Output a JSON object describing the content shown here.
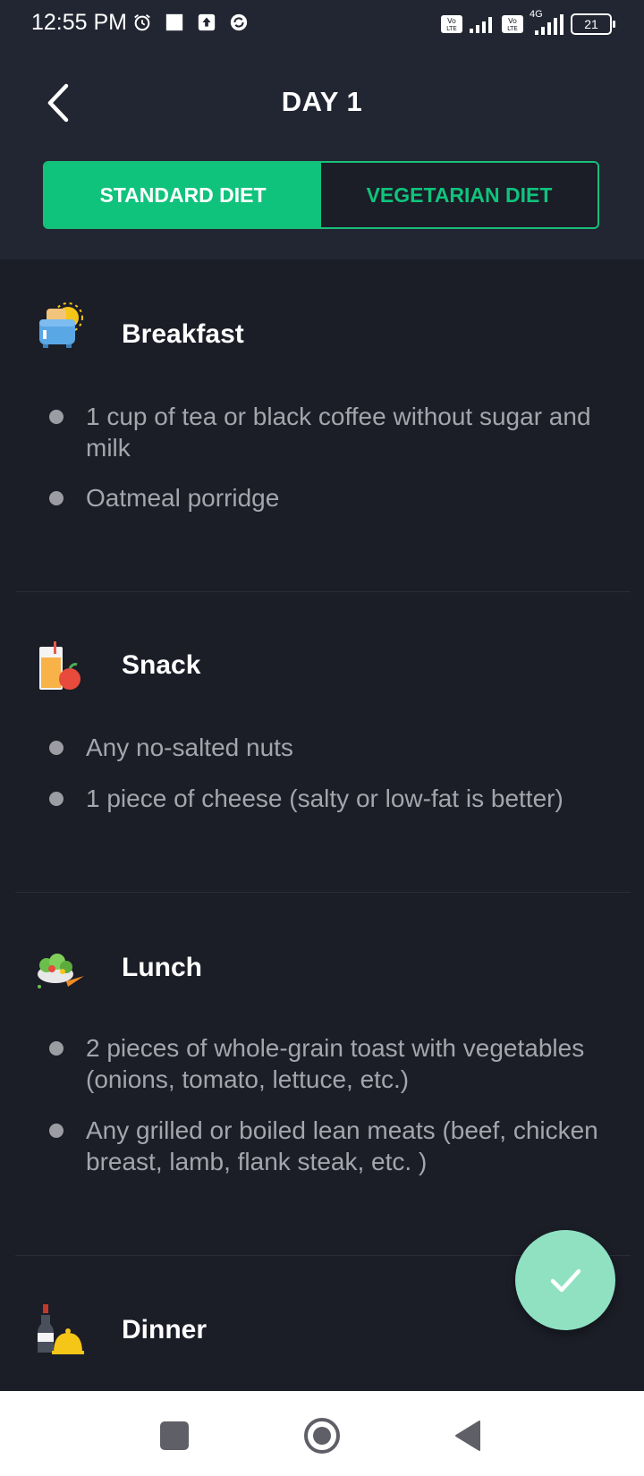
{
  "status_bar": {
    "time": "12:55 PM",
    "network": "4G",
    "battery": "21",
    "icons": [
      "alarm-icon",
      "square-notification-icon",
      "upload-icon",
      "sync-icon",
      "volte-icon",
      "signal-icon",
      "volte-icon",
      "signal-4g-icon",
      "battery-icon"
    ]
  },
  "header": {
    "title": "DAY 1",
    "back_icon": "chevron-left-icon"
  },
  "tabs": [
    {
      "label": "STANDARD DIET",
      "active": true
    },
    {
      "label": "VEGETARIAN DIET",
      "active": false
    }
  ],
  "meals": [
    {
      "title": "Breakfast",
      "icon": "toaster-icon",
      "items": [
        "1 cup of tea or black coffee without sugar and milk",
        "Oatmeal porridge"
      ]
    },
    {
      "title": "Snack",
      "icon": "juice-apple-icon",
      "items": [
        "Any no-salted nuts",
        "1 piece of cheese (salty or low-fat is better)"
      ]
    },
    {
      "title": "Lunch",
      "icon": "salad-icon",
      "items": [
        "2 pieces of whole-grain toast with vegetables (onions, tomato, lettuce, etc.)",
        "Any grilled or boiled lean meats (beef, chicken breast, lamb, flank steak, etc. )"
      ]
    },
    {
      "title": "Dinner",
      "icon": "wine-cloche-icon",
      "items": []
    }
  ],
  "fab": {
    "icon": "checkmark-icon"
  },
  "nav_bar": {
    "icons": [
      "recents-square-icon",
      "home-circle-icon",
      "back-triangle-icon"
    ]
  },
  "colors": {
    "accent": "#10c37c",
    "background": "#1b1d27",
    "header_bg": "#222632",
    "fab": "#8fe1c2",
    "item_text": "#a3a6ad"
  }
}
